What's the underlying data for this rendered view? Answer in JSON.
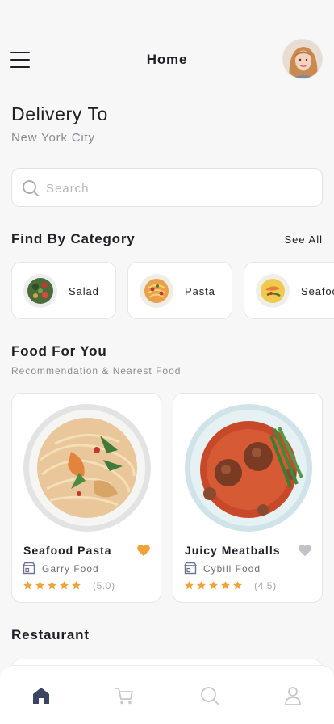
{
  "header": {
    "title": "Home"
  },
  "delivery": {
    "label": "Delivery To",
    "city": "New York City"
  },
  "search": {
    "placeholder": "Search"
  },
  "categories_section": {
    "title": "Find By Category",
    "see_all": "See All",
    "items": [
      {
        "label": "Salad",
        "icon": "salad-bowl"
      },
      {
        "label": "Pasta",
        "icon": "pasta-plate"
      },
      {
        "label": "Seafood",
        "icon": "seafood-plate"
      }
    ]
  },
  "food_section": {
    "title": "Food For You",
    "subtitle": "Recommendation & Nearest Food",
    "items": [
      {
        "name": "Seafood Pasta",
        "restaurant": "Garry Food",
        "stars": 5,
        "rating": "(5.0)",
        "favorite": true,
        "fav_color": "#f0a33a"
      },
      {
        "name": "Juicy Meatballs",
        "restaurant": "Cybill Food",
        "stars": 5,
        "rating": "(4.5)",
        "favorite": false,
        "fav_color": "#c2c2c6"
      }
    ]
  },
  "restaurant_section": {
    "title": "Restaurant"
  },
  "bottom_nav": {
    "items": [
      {
        "icon": "home-icon",
        "active": true
      },
      {
        "icon": "cart-icon",
        "active": false
      },
      {
        "icon": "search-icon",
        "active": false
      },
      {
        "icon": "profile-icon",
        "active": false
      }
    ]
  },
  "colors": {
    "accent": "#f0a33a",
    "active_nav": "#3b4461",
    "inactive_nav": "#c8c8cc"
  }
}
